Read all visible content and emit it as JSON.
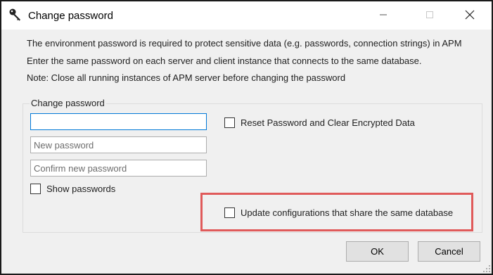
{
  "window": {
    "title": "Change password",
    "icon": "key-icon",
    "controls": [
      "minimize-icon",
      "maximize-icon",
      "close-icon"
    ]
  },
  "messages": {
    "line1": "The environment password is required to protect sensitive data (e.g. passwords, connection strings) in APM",
    "line2": "Enter the same password on each server and client instance that connects to the same database.",
    "line3": "Note: Close all running instances of APM server before changing the password"
  },
  "change_group": {
    "legend": "Change  password",
    "current_password": {
      "value": "",
      "placeholder": ""
    },
    "new_password": {
      "value": "",
      "placeholder": "New password"
    },
    "confirm_password": {
      "value": "",
      "placeholder": "Confirm new password"
    },
    "show_passwords": {
      "label": "Show passwords",
      "checked": false
    },
    "reset_password": {
      "label": "Reset Password and Clear Encrypted Data",
      "checked": false
    },
    "update_configurations": {
      "label": "Update configurations that share the same database",
      "checked": false
    }
  },
  "buttons": {
    "ok_label": "OK",
    "cancel_label": "Cancel"
  },
  "colors": {
    "highlight": "#e05a5a",
    "focus_border": "#0078d7",
    "dialog_bg": "#f0f0f0"
  }
}
